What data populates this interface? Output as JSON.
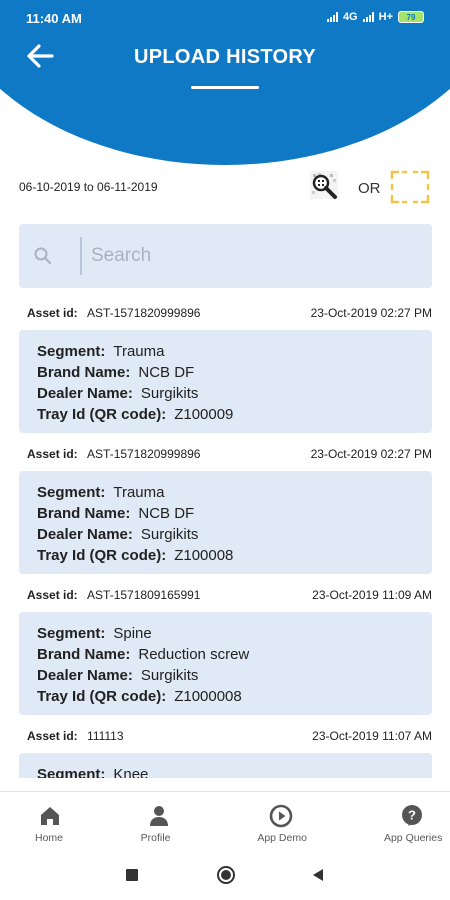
{
  "status_bar": {
    "time": "11:40 AM",
    "network": "4G",
    "network2": "H+",
    "battery": "79"
  },
  "header": {
    "title": "UPLOAD HISTORY",
    "back_icon": "arrow-left-icon",
    "accent_color": "#1079c5"
  },
  "filters": {
    "date_range": "06-10-2019 to 06-11-2019",
    "qr_scan_icon": "qr-scanner-icon",
    "or_text": "OR",
    "scan_frame_icon": "scan-frame-icon"
  },
  "search": {
    "placeholder": "Search",
    "value": ""
  },
  "labels": {
    "asset_id": "Asset id:",
    "segment": "Segment:",
    "brand_name": "Brand Name:",
    "dealer_name": "Dealer Name:",
    "tray_id": "Tray Id (QR code):"
  },
  "entries": [
    {
      "asset_id": "AST-1571820999896",
      "date": "23-Oct-2019 02:27 PM",
      "segment": "Trauma",
      "brand_name": "NCB DF",
      "dealer_name": "Surgikits",
      "tray_id": "Z100009"
    },
    {
      "asset_id": "AST-1571820999896",
      "date": "23-Oct-2019 02:27 PM",
      "segment": "Trauma",
      "brand_name": "NCB DF",
      "dealer_name": "Surgikits",
      "tray_id": "Z100008"
    },
    {
      "asset_id": "AST-1571809165991",
      "date": "23-Oct-2019 11:09 AM",
      "segment": "Spine",
      "brand_name": "Reduction screw",
      "dealer_name": "Surgikits",
      "tray_id": "Z1000008"
    },
    {
      "asset_id": "111113",
      "date": "23-Oct-2019 11:07 AM",
      "segment": "Knee",
      "brand_name": "",
      "dealer_name": "",
      "tray_id": ""
    }
  ],
  "bottom_nav": [
    {
      "label": "Home",
      "icon": "home-icon"
    },
    {
      "label": "Profile",
      "icon": "profile-icon"
    },
    {
      "label": "App Demo",
      "icon": "play-icon"
    },
    {
      "label": "App Queries",
      "icon": "help-icon"
    }
  ],
  "system_nav": {
    "recents_icon": "square-icon",
    "home_icon": "circle-icon",
    "back_icon": "triangle-back-icon"
  }
}
